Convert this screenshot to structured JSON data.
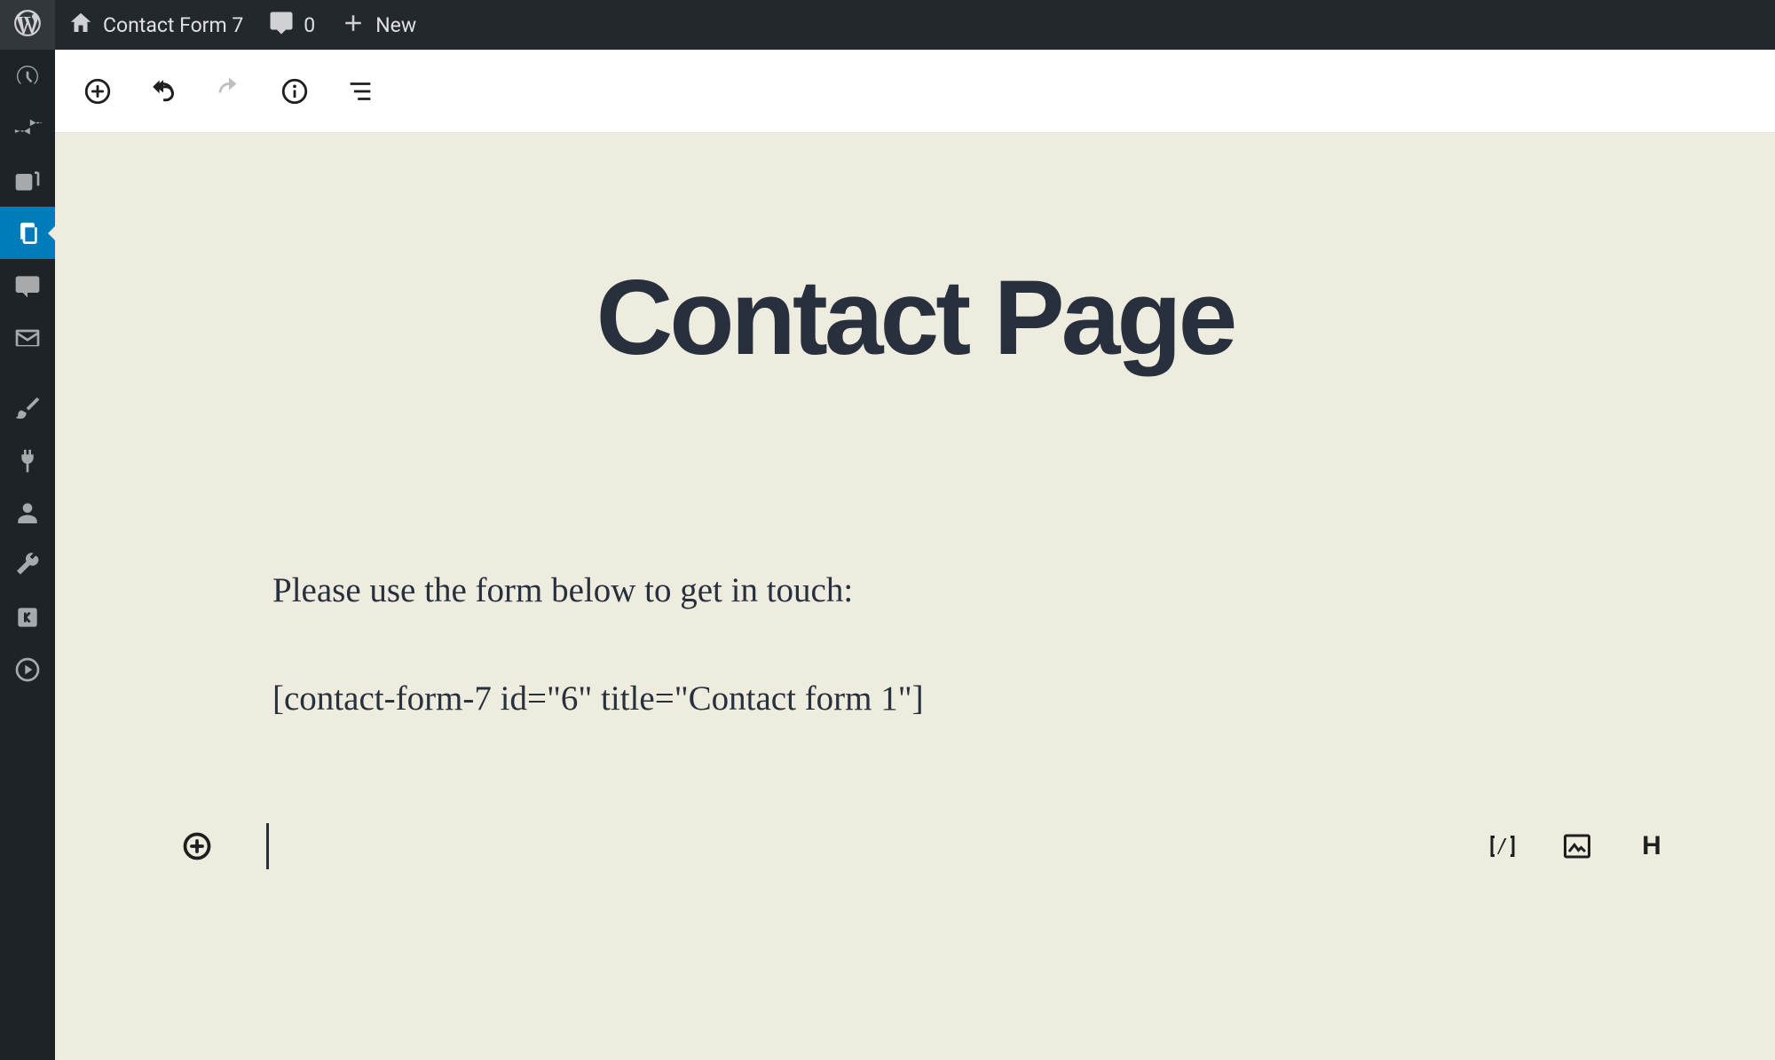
{
  "adminbar": {
    "site_name": "Contact Form 7",
    "comments_count": "0",
    "new_label": "New"
  },
  "sidemenu": {
    "items": [
      {
        "name": "dashboard",
        "icon": "dashboard"
      },
      {
        "name": "posts",
        "icon": "pin"
      },
      {
        "name": "media",
        "icon": "media"
      },
      {
        "name": "pages",
        "icon": "pages",
        "active": true
      },
      {
        "name": "comments",
        "icon": "comment"
      },
      {
        "name": "contact",
        "icon": "mail"
      },
      {
        "name": "appearance",
        "icon": "brush"
      },
      {
        "name": "plugins",
        "icon": "plug"
      },
      {
        "name": "users",
        "icon": "user"
      },
      {
        "name": "tools",
        "icon": "wrench"
      },
      {
        "name": "separator",
        "sep": true
      },
      {
        "name": "arrow",
        "icon": "arrow"
      },
      {
        "name": "play",
        "icon": "play"
      }
    ]
  },
  "editor": {
    "post_title": "Contact Page",
    "paragraph": "Please use the form below to get in touch:",
    "shortcode": "[contact-form-7 id=\"6\" title=\"Contact form 1\"]"
  }
}
